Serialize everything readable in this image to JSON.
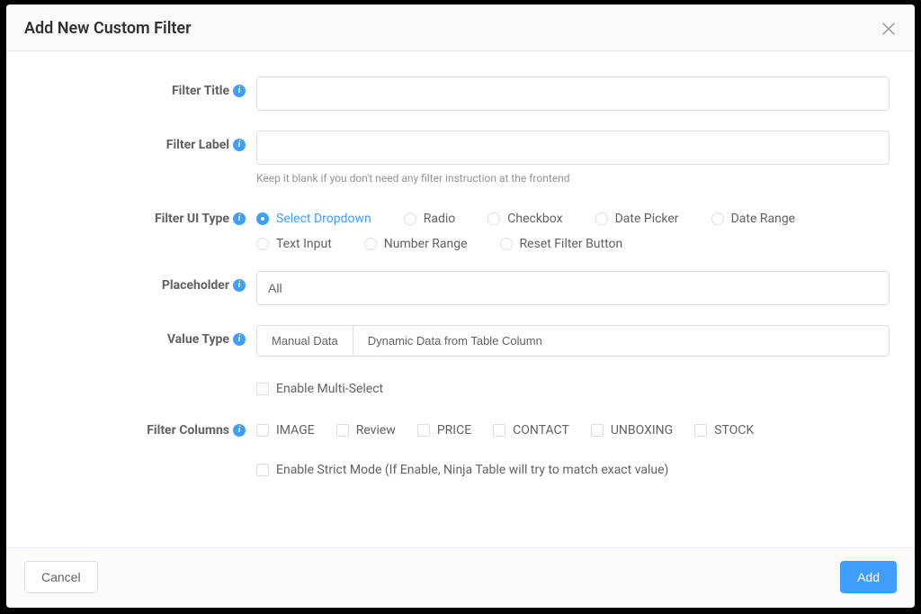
{
  "modal": {
    "title": "Add New Custom Filter"
  },
  "form": {
    "filter_title": {
      "label": "Filter Title",
      "value": ""
    },
    "filter_label": {
      "label": "Filter Label",
      "value": "",
      "helper": "Keep it blank if you don't need any filter instruction at the frontend"
    },
    "filter_ui_type": {
      "label": "Filter UI Type",
      "options": [
        {
          "label": "Select Dropdown",
          "selected": true
        },
        {
          "label": "Radio",
          "selected": false
        },
        {
          "label": "Checkbox",
          "selected": false
        },
        {
          "label": "Date Picker",
          "selected": false
        },
        {
          "label": "Date Range",
          "selected": false
        },
        {
          "label": "Text Input",
          "selected": false
        },
        {
          "label": "Number Range",
          "selected": false
        },
        {
          "label": "Reset Filter Button",
          "selected": false
        }
      ]
    },
    "placeholder": {
      "label": "Placeholder",
      "value": "All"
    },
    "value_type": {
      "label": "Value Type",
      "options": [
        {
          "label": "Manual Data"
        },
        {
          "label": "Dynamic Data from Table Column"
        }
      ]
    },
    "multi_select": {
      "label": "Enable Multi-Select",
      "checked": false
    },
    "filter_columns": {
      "label": "Filter Columns",
      "options": [
        {
          "label": "IMAGE",
          "checked": false
        },
        {
          "label": "Review",
          "checked": false
        },
        {
          "label": "PRICE",
          "checked": false
        },
        {
          "label": "CONTACT",
          "checked": false
        },
        {
          "label": "UNBOXING",
          "checked": false
        },
        {
          "label": "STOCK",
          "checked": false
        }
      ]
    },
    "strict_mode": {
      "label": "Enable Strict Mode (If Enable, Ninja Table will try to match exact value)",
      "checked": false
    }
  },
  "footer": {
    "cancel": "Cancel",
    "add": "Add"
  }
}
